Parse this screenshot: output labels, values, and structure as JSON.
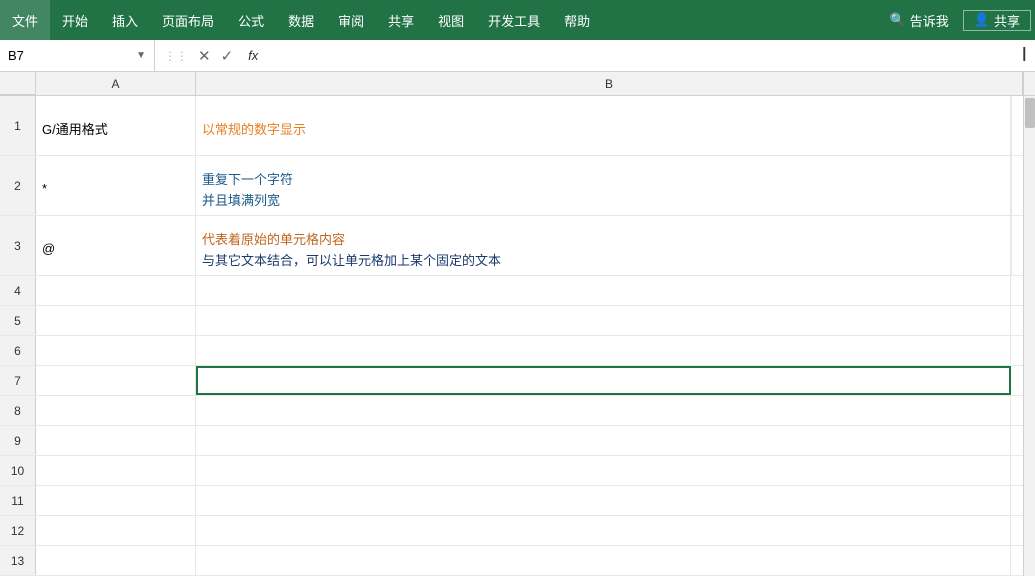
{
  "ribbon": {
    "items": [
      {
        "label": "文件",
        "name": "file"
      },
      {
        "label": "开始",
        "name": "home"
      },
      {
        "label": "插入",
        "name": "insert"
      },
      {
        "label": "页面布局",
        "name": "page-layout"
      },
      {
        "label": "公式",
        "name": "formula"
      },
      {
        "label": "数据",
        "name": "data"
      },
      {
        "label": "审阅",
        "name": "review"
      },
      {
        "label": "共享",
        "name": "share"
      },
      {
        "label": "视图",
        "name": "view"
      },
      {
        "label": "开发工具",
        "name": "developer"
      },
      {
        "label": "帮助",
        "name": "help"
      }
    ],
    "search_placeholder": "告诉我",
    "user_label": "共享"
  },
  "formula_bar": {
    "cell_ref": "B7",
    "cancel_icon": "✕",
    "confirm_icon": "✓",
    "fx_label": "fx"
  },
  "columns": {
    "a_header": "A",
    "b_header": "B"
  },
  "rows": [
    {
      "num": "1",
      "a": "G/通用格式",
      "b_lines": [
        "以常规的数字显示"
      ],
      "b_color": "orange"
    },
    {
      "num": "2",
      "a": "*",
      "b_lines": [
        "重复下一个字符",
        "并且填满列宽"
      ],
      "b_color": "blue"
    },
    {
      "num": "3",
      "a": "@",
      "b_lines": [
        "代表着原始的单元格内容",
        "与其它文本结合，可以让单元格加上某个固定的文本"
      ],
      "b_color": "darkblue"
    },
    {
      "num": "4",
      "a": "",
      "b": ""
    },
    {
      "num": "5",
      "a": "",
      "b": ""
    },
    {
      "num": "6",
      "a": "",
      "b": ""
    },
    {
      "num": "7",
      "a": "",
      "b": ""
    },
    {
      "num": "8",
      "a": "",
      "b": ""
    },
    {
      "num": "9",
      "a": "",
      "b": ""
    },
    {
      "num": "10",
      "a": "",
      "b": ""
    },
    {
      "num": "11",
      "a": "",
      "b": ""
    },
    {
      "num": "12",
      "a": "",
      "b": ""
    },
    {
      "num": "13",
      "a": "",
      "b": ""
    }
  ]
}
